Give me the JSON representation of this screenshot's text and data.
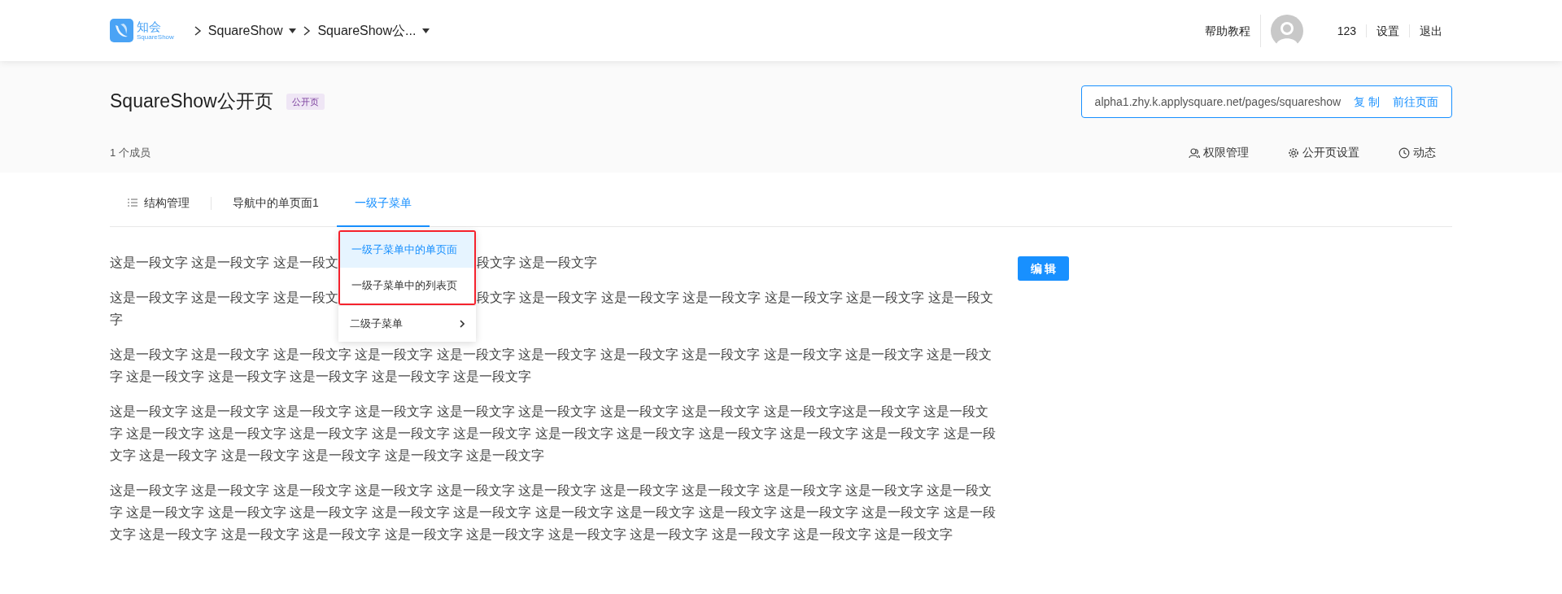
{
  "header": {
    "logo": {
      "name": "知会",
      "subtitle": "SquareShow"
    },
    "breadcrumbs": [
      {
        "label": "SquareShow"
      },
      {
        "label": "SquareShow公..."
      }
    ],
    "nav": [
      {
        "kind": "link",
        "label": "帮助教程"
      },
      {
        "kind": "avatar"
      },
      {
        "kind": "link",
        "label": "123"
      },
      {
        "kind": "link",
        "label": "设置"
      },
      {
        "kind": "link",
        "label": "退出"
      }
    ]
  },
  "page": {
    "title": "SquareShow公开页",
    "badge": "公开页",
    "url": "alpha1.zhy.k.applysquare.net/pages/squareshow",
    "copy": "复 制",
    "go": "前往页面",
    "members": "1 个成员",
    "actions": [
      {
        "label": "权限管理"
      },
      {
        "label": "公开页设置"
      },
      {
        "label": "动态"
      }
    ]
  },
  "tabs": [
    {
      "label": "结构管理",
      "selected": false
    },
    {
      "label": "导航中的单页面1",
      "selected": false
    },
    {
      "label": "一级子菜单",
      "selected": true
    }
  ],
  "dropdown": {
    "groups": [
      {
        "outlined": true,
        "items": [
          {
            "label": "一级子菜单中的单页面",
            "selected": true,
            "kind": "item"
          },
          {
            "label": "一级子菜单中的列表页",
            "selected": false,
            "kind": "item"
          }
        ]
      },
      {
        "outlined": false,
        "items": [
          {
            "label": "二级子菜单",
            "selected": false,
            "kind": "submenu"
          }
        ]
      }
    ]
  },
  "paragraphs": [
    [
      [
        "这是一段文字 这是一段文字 这是一段文",
        "段文字 这是一段文字"
      ]
    ],
    [
      [
        "这是一段文字 这是一段文字 这是一段文",
        "段文字 这是一段文字 这是一段文字 这是一段文字 这是一段文字 这是一段文字 这是一段文"
      ],
      [
        "字"
      ]
    ],
    [
      [
        "这是一段文字 这是一段文字 这是一段文字 这是一段文字 这是一段文字 这是一段文字 这是一段文字 这是一段文字 这是一段文字 这是一段文字 这是一段文字 这是一段文字 这是一段文字 这是一段文字 这是一段文字 这是一段文字"
      ]
    ],
    [
      [
        "这是一段文字 这是一段文字 这是一段文字 这是一段文字 这是一段文字 这是一段文字 这是一段文字 这是一段文字 这是一段文字这是一段文字 这是一段文字 这是一段文字 这是一段文字 这是一段文字 这是一段文字 这是一段文字 这是一段文字 这是一段文字 这是一段文字 这是一段文字 这是一段文字 这是一段文字 这是一段文字 这是一段文字 这是一段文字 这是一段文字 这是一段文字"
      ]
    ],
    [
      [
        "这是一段文字 这是一段文字 这是一段文字 这是一段文字 这是一段文字 这是一段文字 这是一段文字 这是一段文字 这是一段文字 这是一段文字 这是一段文字 这是一段文字 这是一段文字 这是一段文字 这是一段文字 这是一段文字 这是一段文字 这是一段文字 这是一段文字 这是一段文字 这是一段文字 这是一段文字 这是一段文字 这是一段文字 这是一段文字 这是一段文字 这是一段文字 这是一段文字 这是一段文字 这是一段文字 这是一段文字 这是一段文字"
      ]
    ]
  ],
  "edit_button": "编 辑"
}
